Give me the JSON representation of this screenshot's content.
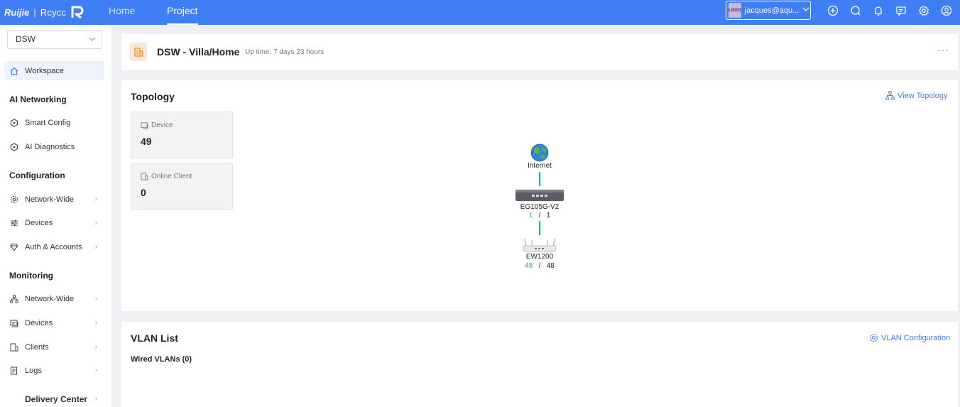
{
  "topbar": {
    "brand": "Ruijie",
    "brand_sep": "|",
    "brand_sub": "Rcycc",
    "nav": {
      "home": "Home",
      "project": "Project"
    },
    "account": {
      "logo_text": "LOGO",
      "email": "jacques@aqu..."
    },
    "icons": [
      "add-icon",
      "search-icon",
      "bell-icon",
      "message-icon",
      "gear-icon",
      "user-icon"
    ]
  },
  "sidebar": {
    "project_select": "DSW",
    "workspace": "Workspace",
    "ai_networking": {
      "title": "AI Networking",
      "items": [
        "Smart Config",
        "AI Diagnostics"
      ]
    },
    "configuration": {
      "title": "Configuration",
      "items": [
        "Network-Wide",
        "Devices",
        "Auth & Accounts"
      ]
    },
    "monitoring": {
      "title": "Monitoring",
      "items": [
        "Network-Wide",
        "Devices",
        "Clients",
        "Logs"
      ]
    },
    "delivery_center": "Delivery Center"
  },
  "project": {
    "name": "DSW - Villa/Home",
    "uptime": "Up time: 7 days 23 hours"
  },
  "topology": {
    "title": "Topology",
    "view_link": "View Topology",
    "stats": [
      {
        "label": "Device",
        "value": "49"
      },
      {
        "label": "Online Client",
        "value": "0"
      }
    ],
    "nodes": {
      "internet": "Internet",
      "gateway": {
        "name": "EG105G-V2",
        "online": "1",
        "sep": "/",
        "total": "1"
      },
      "ap": {
        "name": "EW1200",
        "online": "48",
        "sep": "/",
        "total": "48"
      }
    }
  },
  "vlan": {
    "title": "VLAN List",
    "config_link": "VLAN Configuration",
    "wired": "Wired VLANs (0)"
  },
  "colors": {
    "primary": "#3f7ef5",
    "online": "#2eb34a",
    "link_line": "#1db78f"
  }
}
